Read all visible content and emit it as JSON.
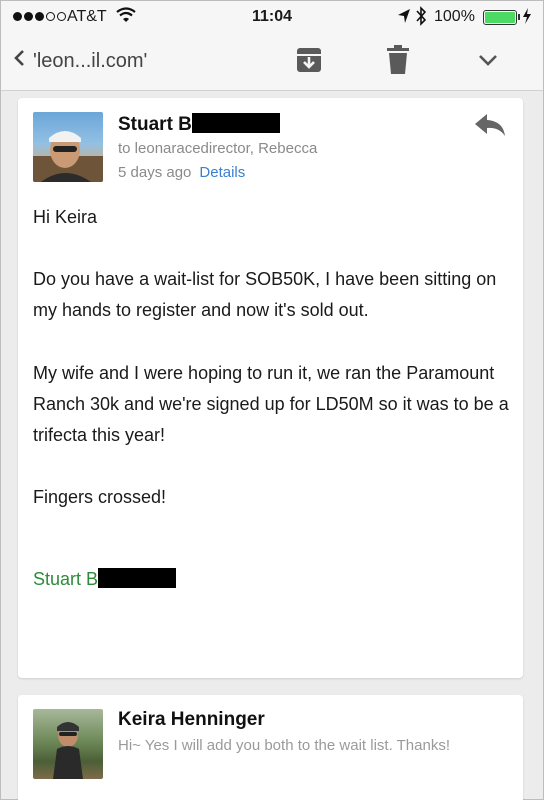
{
  "status_bar": {
    "carrier": "AT&T",
    "time": "11:04",
    "battery_percent": "100%",
    "battery_level": 1.0,
    "signal_bars_filled": 3,
    "signal_bars_total": 5
  },
  "toolbar": {
    "back_label": "'leon...il.com'",
    "icons": [
      "chevron-left-icon",
      "archive-icon",
      "trash-icon",
      "chevron-down-icon"
    ]
  },
  "message1": {
    "sender": "Stuart B",
    "recipients": "to leonaracedirector, Rebecca",
    "date": "5 days ago",
    "details_link": "Details",
    "greeting": "Hi Keira",
    "paragraph1": "Do you have a wait-list for SOB50K, I have been sitting on my hands to register and now it's sold out.",
    "paragraph2": "My wife and I were hoping to run it, we ran the Paramount Ranch 30k and we're signed up for LD50M so it was to be a trifecta this year!",
    "paragraph3": "Fingers crossed!",
    "signature": "Stuart B"
  },
  "message2": {
    "sender": "Keira Henninger",
    "snippet": "Hi~ Yes I will add you both to the wait list. Thanks!"
  },
  "colors": {
    "link": "#3b7fd0",
    "signature": "#2e8b3a",
    "battery": "#4cd964"
  }
}
